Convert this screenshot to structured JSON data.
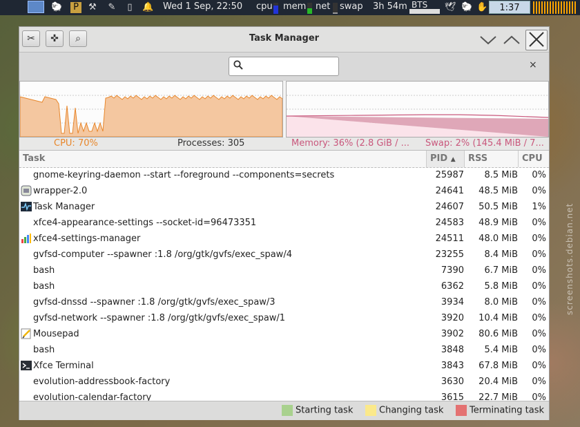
{
  "panel": {
    "datetime": "Wed  1 Sep, 22:50",
    "cpu_label": "cpu",
    "mem_label": "mem",
    "net_label": "net",
    "swap_label": "swap",
    "uptime": "3h 54m",
    "bts_label": "BTS",
    "battery_time": "1:37",
    "cpu_level": 0.75,
    "mem_level": 0.5,
    "net_level": 0.1
  },
  "window": {
    "title": "Task Manager",
    "search_placeholder": "",
    "clear_glyph": "×"
  },
  "graphs": {
    "cpu_text": "CPU: 70%",
    "processes_text": "Processes: 305",
    "memory_text": "Memory: 36% (2.8 GiB / ...",
    "swap_text": "Swap: 2% (145.4 MiB / 7...",
    "cpu_color": "#e8862a",
    "memory_color": "#c9577c"
  },
  "columns": {
    "task": "Task",
    "pid": "PID",
    "rss": "RSS",
    "cpu": "CPU"
  },
  "rows": [
    {
      "name": "gnome-keyring-daemon --start --foreground --components=secrets",
      "pid": "25987",
      "rss": "8.5  MiB",
      "cpu": "0%",
      "icon": "none"
    },
    {
      "name": "wrapper-2.0",
      "pid": "24641",
      "rss": "48.5  MiB",
      "cpu": "0%",
      "icon": "wrapper-icon"
    },
    {
      "name": "Task Manager",
      "pid": "24607",
      "rss": "50.5  MiB",
      "cpu": "1%",
      "icon": "task-manager-icon"
    },
    {
      "name": "xfce4-appearance-settings --socket-id=96473351",
      "pid": "24583",
      "rss": "48.9  MiB",
      "cpu": "0%",
      "icon": "none"
    },
    {
      "name": "xfce4-settings-manager",
      "pid": "24511",
      "rss": "48.0  MiB",
      "cpu": "0%",
      "icon": "settings-manager-icon"
    },
    {
      "name": "gvfsd-computer --spawner :1.8 /org/gtk/gvfs/exec_spaw/4",
      "pid": "23255",
      "rss": "8.4  MiB",
      "cpu": "0%",
      "icon": "none"
    },
    {
      "name": "bash",
      "pid": "7390",
      "rss": "6.7  MiB",
      "cpu": "0%",
      "icon": "none"
    },
    {
      "name": "bash",
      "pid": "6362",
      "rss": "5.8  MiB",
      "cpu": "0%",
      "icon": "none"
    },
    {
      "name": "gvfsd-dnssd --spawner :1.8 /org/gtk/gvfs/exec_spaw/3",
      "pid": "3934",
      "rss": "8.0  MiB",
      "cpu": "0%",
      "icon": "none"
    },
    {
      "name": "gvfsd-network --spawner :1.8 /org/gtk/gvfs/exec_spaw/1",
      "pid": "3920",
      "rss": "10.4  MiB",
      "cpu": "0%",
      "icon": "none"
    },
    {
      "name": "Mousepad",
      "pid": "3902",
      "rss": "80.6  MiB",
      "cpu": "0%",
      "icon": "mousepad-icon"
    },
    {
      "name": "bash",
      "pid": "3848",
      "rss": "5.4  MiB",
      "cpu": "0%",
      "icon": "none"
    },
    {
      "name": "Xfce Terminal",
      "pid": "3843",
      "rss": "67.8  MiB",
      "cpu": "0%",
      "icon": "terminal-icon"
    },
    {
      "name": "evolution-addressbook-factory",
      "pid": "3630",
      "rss": "20.4  MiB",
      "cpu": "0%",
      "icon": "none"
    },
    {
      "name": "evolution-calendar-factory",
      "pid": "3615",
      "rss": "22.7  MiB",
      "cpu": "0%",
      "icon": "none"
    }
  ],
  "legend": [
    {
      "label": "Starting task",
      "color": "#a9d18e"
    },
    {
      "label": "Changing task",
      "color": "#fbe98a"
    },
    {
      "label": "Terminating task",
      "color": "#e47272"
    }
  ],
  "watermark": "screenshots.debian.net"
}
